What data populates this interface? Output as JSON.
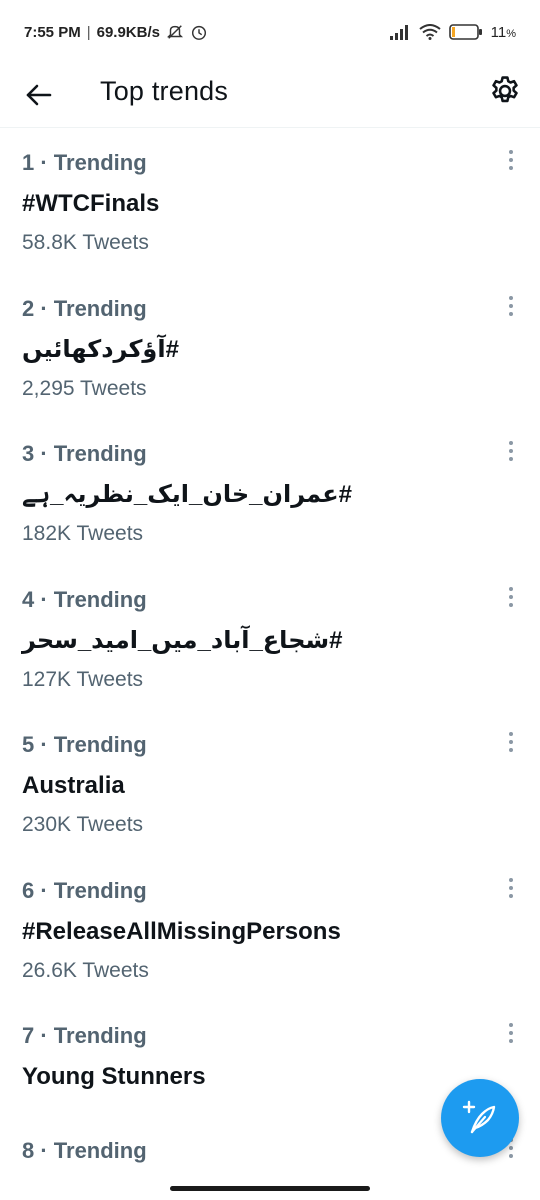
{
  "status_bar": {
    "time": "7:55 PM",
    "separator": "|",
    "network_speed": "69.9KB/s",
    "battery": "11"
  },
  "header": {
    "title": "Top trends"
  },
  "trends": [
    {
      "meta": "1 · Trending",
      "name": "#WTCFinals",
      "count": "58.8K Tweets"
    },
    {
      "meta": "2 · Trending",
      "name": "#آؤکردکھائیں",
      "count": "2,295 Tweets"
    },
    {
      "meta": "3 · Trending",
      "name": "#عمران_خان_ایک_نظریہ_ہے",
      "count": "182K Tweets"
    },
    {
      "meta": "4 · Trending",
      "name": "#شجاع_آباد_میں_امید_سحر",
      "count": "127K Tweets"
    },
    {
      "meta": "5 · Trending",
      "name": "Australia",
      "count": "230K Tweets"
    },
    {
      "meta": "6 · Trending",
      "name": "#ReleaseAllMissingPersons",
      "count": "26.6K Tweets"
    },
    {
      "meta": "7 · Trending",
      "name": "Young Stunners",
      "count": ""
    },
    {
      "meta": "8 · Trending",
      "name": "",
      "count": ""
    }
  ],
  "colors": {
    "accent": "#1d9bf0",
    "secondary_text": "#536471",
    "primary_text": "#0f1419"
  },
  "icons": {
    "back": "arrow-left-icon",
    "settings": "gear-icon",
    "more": "more-vertical-icon",
    "compose": "feather-plus-icon"
  }
}
